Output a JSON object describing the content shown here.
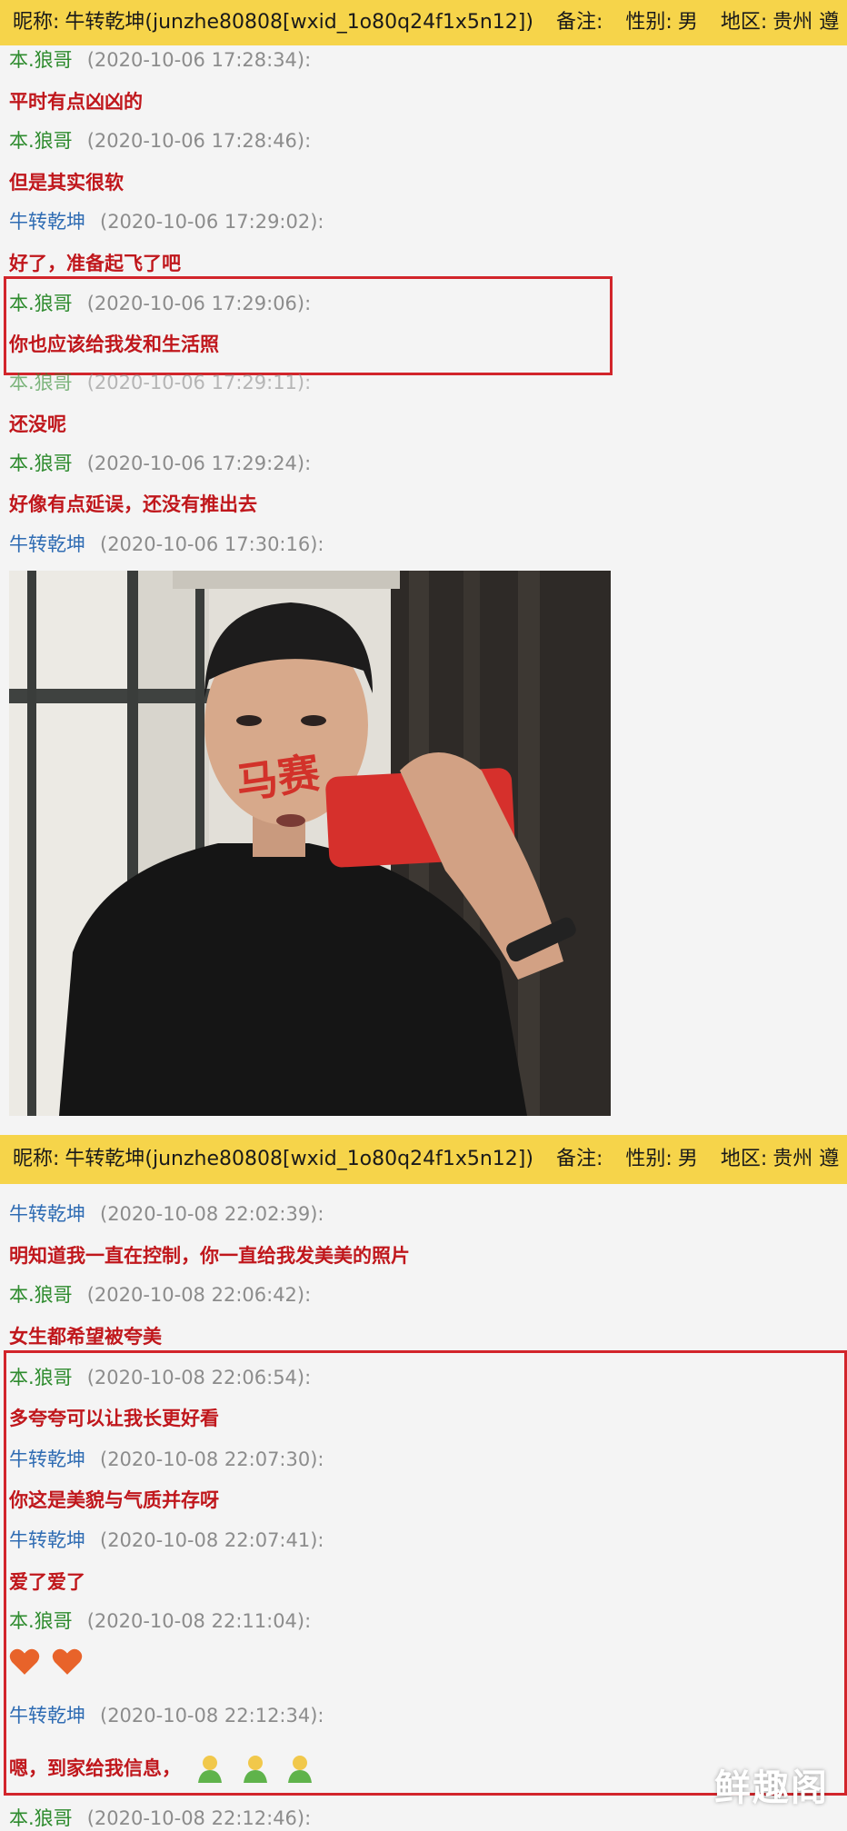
{
  "header": {
    "nickname_label": "昵称:",
    "nickname": "牛转乾坤(junzhe80808[wxid_1o80q24f1x5n12])",
    "remark_label": "备注:",
    "gender_label": "性别:",
    "gender": "男",
    "region_label": "地区:",
    "region": "贵州 遵"
  },
  "chat1": [
    {
      "sender": "本.狼哥",
      "time": "(2020-10-06 17:28:34):",
      "text": "平时有点凶凶的"
    },
    {
      "sender": "本.狼哥",
      "time": "(2020-10-06 17:28:46):",
      "text": "但是其实很软"
    },
    {
      "sender": "牛转乾坤",
      "time": "(2020-10-06 17:29:02):",
      "text": "好了，准备起飞了吧"
    },
    {
      "sender": "本.狼哥",
      "time": "(2020-10-06 17:29:06):",
      "text": "你也应该给我发和生活照"
    },
    {
      "sender": "本.狼哥",
      "time": "(2020-10-06 17:29:11):",
      "text": "还没呢"
    },
    {
      "sender": "本.狼哥",
      "time": "(2020-10-06 17:29:24):",
      "text": "好像有点延误，还没有推出去"
    },
    {
      "sender": "牛转乾坤",
      "time": "(2020-10-06 17:30:16):",
      "text": ""
    }
  ],
  "photo_annotation": "马赛",
  "chat2": [
    {
      "sender": "牛转乾坤",
      "time": "(2020-10-08 22:02:39):",
      "text": "明知道我一直在控制，你一直给我发美美的照片"
    },
    {
      "sender": "本.狼哥",
      "time": "(2020-10-08 22:06:42):",
      "text": "女生都希望被夸美"
    },
    {
      "sender": "本.狼哥",
      "time": "(2020-10-08 22:06:54):",
      "text": "多夸夸可以让我长更好看"
    },
    {
      "sender": "牛转乾坤",
      "time": "(2020-10-08 22:07:30):",
      "text": "你这是美貌与气质并存呀"
    },
    {
      "sender": "牛转乾坤",
      "time": "(2020-10-08 22:07:41):",
      "text": "爱了爱了"
    },
    {
      "sender": "本.狼哥",
      "time": "(2020-10-08 22:11:04):",
      "text": ""
    },
    {
      "sender": "牛转乾坤",
      "time": "(2020-10-08 22:12:34):",
      "text": "嗯，到家给我信息，"
    },
    {
      "sender": "本.狼哥",
      "time": "(2020-10-08 22:12:46):",
      "text": ""
    }
  ],
  "icons": {
    "heart": "heart-icon",
    "emoji": "bowing-person-icon"
  },
  "watermark": "鲜趣阁",
  "colors": {
    "header_bg": "#f6d44a",
    "sender_a": "#2e8b2e",
    "sender_b": "#2f6cb3",
    "message": "#c0171c",
    "highlight_box": "#d2252b"
  }
}
